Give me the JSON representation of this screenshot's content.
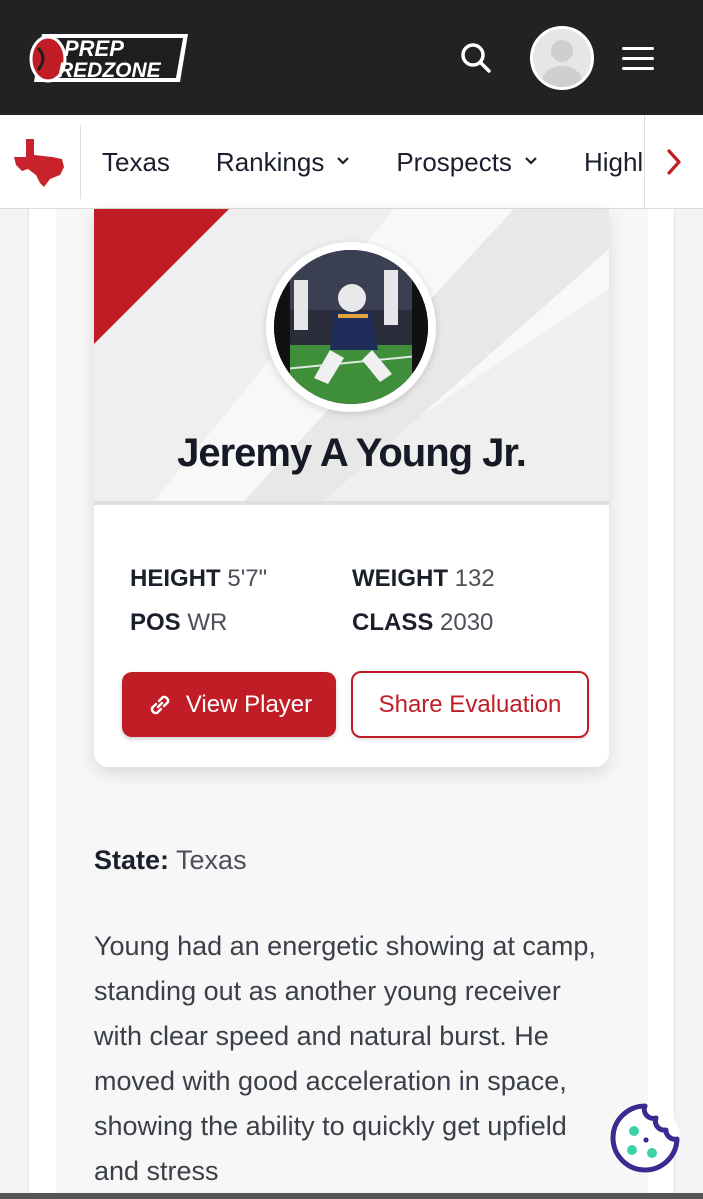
{
  "header": {
    "logo_top": "PREP",
    "logo_bottom": "REDZONE",
    "icons": {
      "search": "search-icon",
      "avatar": "user-avatar",
      "menu": "hamburger-menu-icon"
    }
  },
  "nav": {
    "state_icon": "texas-state-icon",
    "items": [
      {
        "label": "Texas",
        "dropdown": false
      },
      {
        "label": "Rankings",
        "dropdown": true
      },
      {
        "label": "Prospects",
        "dropdown": true
      },
      {
        "label": "Highlights",
        "dropdown": false
      }
    ],
    "more_icon": "chevron-right-icon"
  },
  "player": {
    "name": "Jeremy A Young Jr.",
    "height_label": "HEIGHT",
    "height": "5'7\"",
    "weight_label": "WEIGHT",
    "weight": "132",
    "pos_label": "POS",
    "pos": "WR",
    "class_label": "CLASS",
    "class": "2030",
    "view_button": "View Player",
    "share_button": "Share Evaluation"
  },
  "article": {
    "state_label": "State:",
    "state_value": "Texas",
    "body": "Young had an energetic showing at camp, standing out as another young receiver with clear speed and natural burst. He moved with good acceleration in space, showing the ability to quickly get upfield and stress"
  },
  "colors": {
    "brand_red": "#c01d27",
    "header_bg": "#222222",
    "cookie_purple": "#3b2a8f",
    "cookie_teal": "#3ed1a8"
  }
}
